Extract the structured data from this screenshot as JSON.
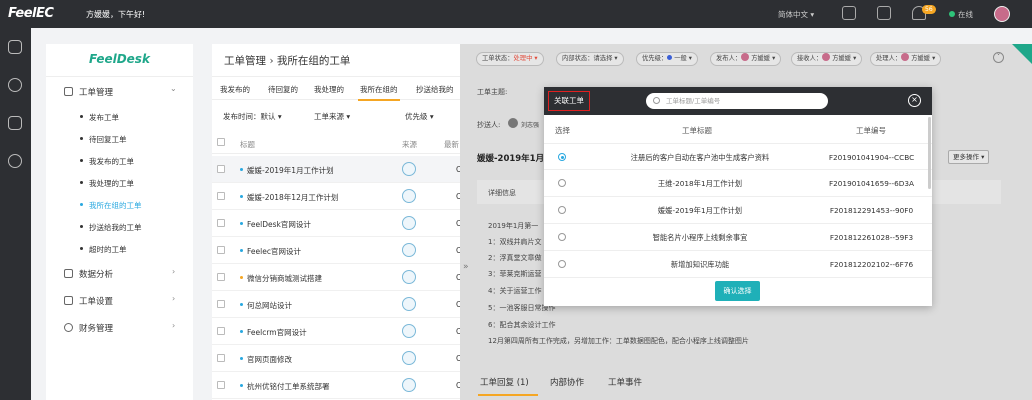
{
  "topbar": {
    "logo": "FeelEC",
    "greeting": "方媛媛，下午好!",
    "language": "简体中文 ▾",
    "notification_count": "56",
    "status": "在线"
  },
  "sidebar": {
    "logo": "FeelDesk",
    "groups": [
      {
        "label": "工单管理",
        "arrow": "⌄"
      },
      {
        "label": "数据分析",
        "arrow": "›"
      },
      {
        "label": "工单设置",
        "arrow": "›"
      },
      {
        "label": "财务管理",
        "arrow": "›"
      }
    ],
    "items": [
      {
        "label": "发布工单"
      },
      {
        "label": "待回复工单"
      },
      {
        "label": "我发布的工单"
      },
      {
        "label": "我处理的工单"
      },
      {
        "label": "我所在组的工单"
      },
      {
        "label": "抄送给我的工单"
      },
      {
        "label": "超时的工单"
      }
    ]
  },
  "main": {
    "title": "工单管理 › 我所在组的工单",
    "tabs": [
      {
        "label": "我发布的"
      },
      {
        "label": "待回复的"
      },
      {
        "label": "我处理的"
      },
      {
        "label": "我所在组的"
      },
      {
        "label": "抄送给我的"
      }
    ],
    "filters": [
      {
        "label": "发布时间：默认 ▾"
      },
      {
        "label": "工单来源 ▾"
      },
      {
        "label": "优先级 ▾"
      }
    ],
    "columns": {
      "title": "标题",
      "source": "来源",
      "latest": "最新"
    },
    "rows": [
      {
        "title": "媛媛-2019年1月工作计划",
        "c": "C"
      },
      {
        "title": "媛媛-2018年12月工作计划",
        "c": "C"
      },
      {
        "title": "FeelDesk官网设计",
        "c": "C"
      },
      {
        "title": "Feelec官网设计",
        "c": "C"
      },
      {
        "title": "微信分销商城测试搭建",
        "c": "C"
      },
      {
        "title": "何总网站设计",
        "c": "C"
      },
      {
        "title": "Feelcrm官网设计",
        "c": "C"
      },
      {
        "title": "官网页面修改",
        "c": "C"
      },
      {
        "title": "杭州优铭付工单系统部署",
        "c": "C"
      }
    ]
  },
  "detail": {
    "pills": [
      {
        "label": "工单状态：",
        "value": "处理中 ▾"
      },
      {
        "label": "内部状态：",
        "value": "请选择 ▾"
      },
      {
        "label": "优先级：",
        "value": "一般 ▾"
      },
      {
        "label": "发布人：",
        "value": "方媛媛 ▾"
      },
      {
        "label": "接收人：",
        "value": "方媛媛 ▾"
      },
      {
        "label": "处理人：",
        "value": "方媛媛 ▾"
      }
    ],
    "subject_label": "工单主题:",
    "cc_label": "抄送人:",
    "cc_name": "刘志强",
    "heading": "媛媛-2019年1月",
    "more_ops": "更多操作 ▾",
    "info_title": "详细信息",
    "lines": [
      "2019年1月第一",
      "1：双线并肩片文",
      "2：浮真堂文章做",
      "3：菲莱克斯运营",
      "4：关于运营工作",
      "5：一池客服日常操作",
      "6：配合其余设计工作",
      "12月第四周所有工作完成，另增加工作：工单数据图配色，配合小程序上线调整图片"
    ],
    "bottom_tabs": [
      "工单回复 (1)",
      "内部协作",
      "工单事件"
    ],
    "collapse": "»"
  },
  "modal": {
    "title": "关联工单",
    "search_placeholder": "工单标题/工单编号",
    "close": "×",
    "columns": {
      "select": "选择",
      "title": "工单标题",
      "number": "工单编号"
    },
    "rows": [
      {
        "title": "注册后的客户自动在客户池中生成客户资料",
        "number": "F20190104190​4--CCBC",
        "selected": true
      },
      {
        "title": "王维-2018年1月工作计划",
        "number": "F201901041659--6D3A",
        "selected": false
      },
      {
        "title": "媛媛-2019年1月工作计划",
        "number": "F201812291453--90F0",
        "selected": false
      },
      {
        "title": "智能名片小程序上线剩余事宜",
        "number": "F201812261028--59F3",
        "selected": false
      },
      {
        "title": "新增加知识库功能",
        "number": "F201812202102--6F76",
        "selected": false
      }
    ],
    "confirm": "确认选择"
  }
}
